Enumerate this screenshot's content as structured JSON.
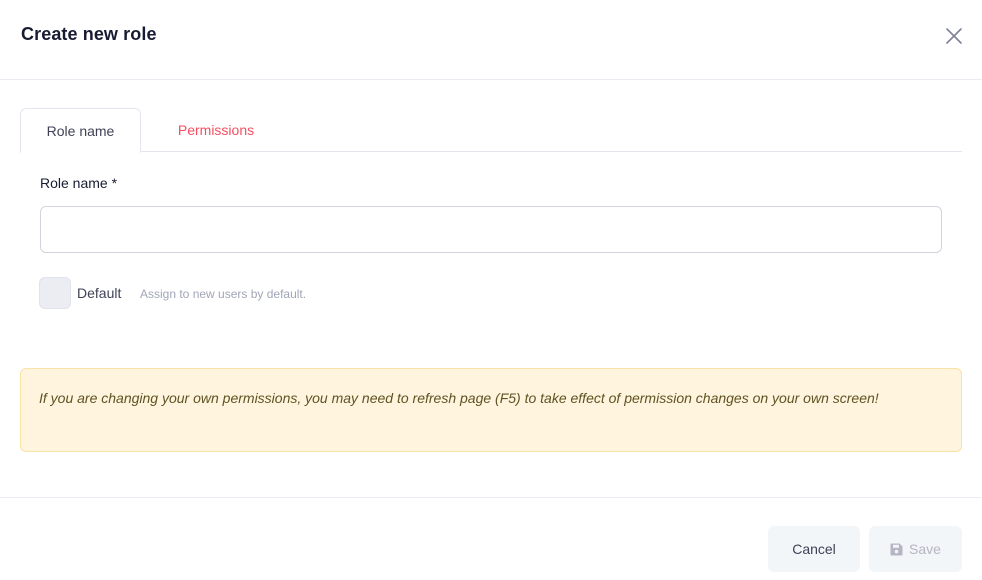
{
  "modal": {
    "title": "Create new role",
    "close_icon": "close-icon"
  },
  "tabs": [
    {
      "label": "Role name",
      "active": true
    },
    {
      "label": "Permissions",
      "active": false
    }
  ],
  "form": {
    "role_name_label": "Role name *",
    "role_name_value": "",
    "default_checkbox_checked": false,
    "default_label": "Default",
    "default_hint": "Assign to new users by default."
  },
  "alert": {
    "text": "If you are changing your own permissions, you may need to refresh page (F5) to take effect of permission changes on your own screen!"
  },
  "footer": {
    "cancel_label": "Cancel",
    "save_label": "Save",
    "save_icon": "save-icon"
  },
  "colors": {
    "accent_red": "#f64e60",
    "alert_background": "#fff4de",
    "alert_text": "#5e5322",
    "button_background": "#f3f6f9"
  }
}
